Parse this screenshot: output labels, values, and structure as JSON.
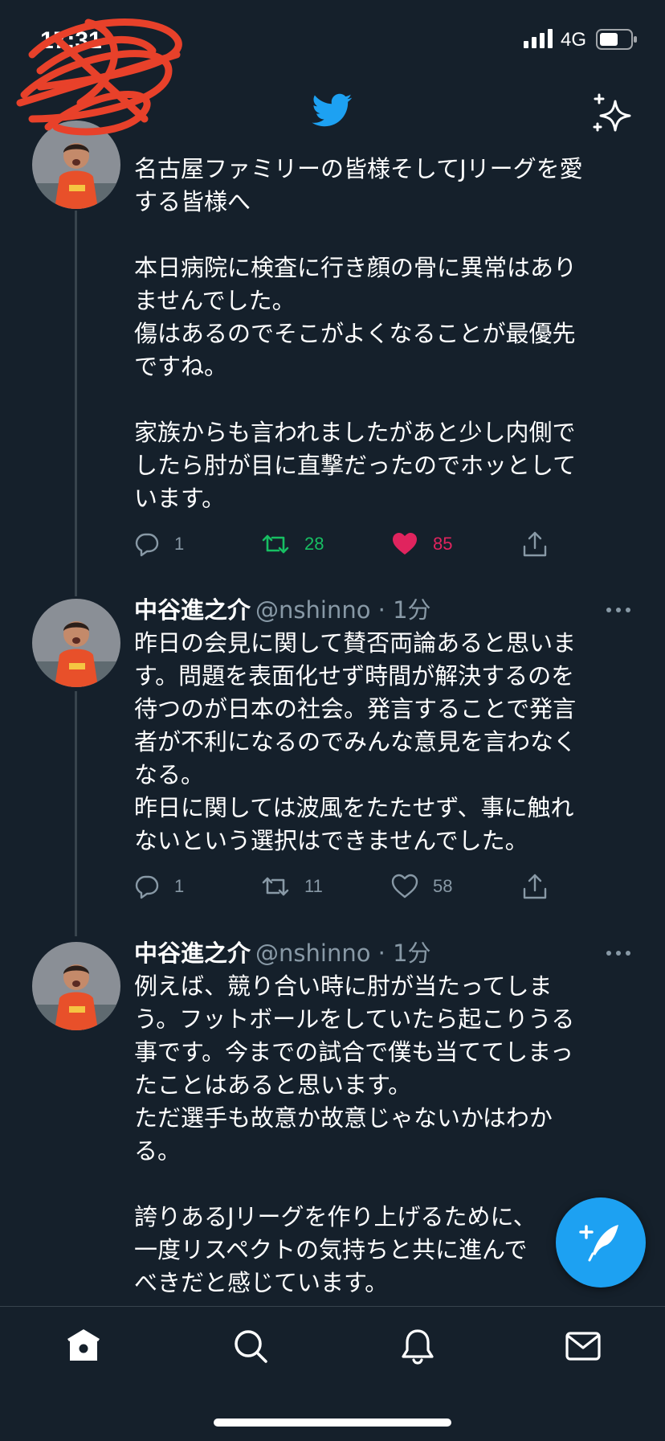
{
  "status_bar": {
    "time": "17:31",
    "network": "4G"
  },
  "header": {
    "logo_icon": "twitter-bird-icon",
    "sparkle_icon": "sparkle-icon"
  },
  "tweets": [
    {
      "text": "名古屋ファミリーの皆様そしてJリーグを愛\nする皆様へ\n\n本日病院に検査に行き顔の骨に異常はあり\nませんでした。\n傷はあるのでそこがよくなることが最優先\nですね。\n\n家族からも言われましたがあと少し内側で\nしたら肘が目に直撃だったのでホッとして\nいます。",
      "replies": "1",
      "retweets": "28",
      "likes": "85"
    },
    {
      "name": "中谷進之介",
      "handle": "@nshinno",
      "dot": "·",
      "time": "1分",
      "text": "昨日の会見に関して賛否両論あると思いま\nす。問題を表面化せず時間が解決するのを\n待つのが日本の社会。発言することで発言\n者が不利になるのでみんな意見を言わなく\nなる。\n昨日に関しては波風をたたせず、事に触れ\nないという選択はできませんでした。",
      "replies": "1",
      "retweets": "11",
      "likes": "58"
    },
    {
      "name": "中谷進之介",
      "handle": "@nshinno",
      "dot": "·",
      "time": "1分",
      "text": "例えば、競り合い時に肘が当たってしま\nう。フットボールをしていたら起こりうる\n事です。今までの試合で僕も当ててしまっ\nたことはあると思います。\nただ選手も故意か故意じゃないかはわか\nる。\n\n誇りあるJリーグを作り上げるために、\n一度リスペクトの気持ちと共に進んで\nべきだと感じています。"
    }
  ],
  "colors": {
    "background": "#15202b",
    "accent": "#1da1f2",
    "secondary_text": "#8899a6",
    "retweet_active": "#17bf63",
    "like_active": "#e0245e",
    "divider": "#38444d"
  },
  "tab_bar": {
    "items": [
      "home-icon",
      "search-icon",
      "notifications-icon",
      "messages-icon"
    ]
  },
  "compose_button": {
    "icon": "compose-tweet-icon"
  }
}
